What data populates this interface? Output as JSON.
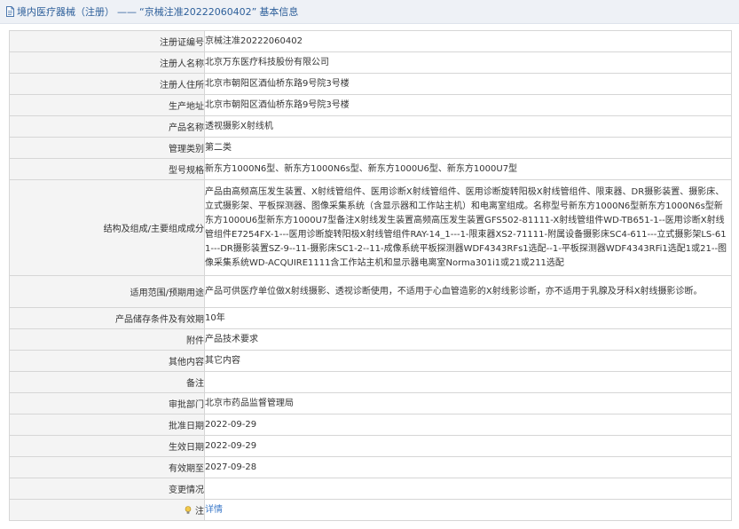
{
  "header": {
    "title": "境内医疗器械（注册）",
    "separator": "——",
    "cert_quote": "“京械注准20222060402”",
    "suffix": "基本信息"
  },
  "rows": [
    {
      "label": "注册证编号",
      "value": "京械注准20222060402"
    },
    {
      "label": "注册人名称",
      "value": "北京万东医疗科技股份有限公司"
    },
    {
      "label": "注册人住所",
      "value": "北京市朝阳区酒仙桥东路9号院3号楼"
    },
    {
      "label": "生产地址",
      "value": "北京市朝阳区酒仙桥东路9号院3号楼"
    },
    {
      "label": "产品名称",
      "value": "透视摄影X射线机"
    },
    {
      "label": "管理类别",
      "value": "第二类"
    },
    {
      "label": "型号规格",
      "value": "新东方1000N6型、新东方1000N6s型、新东方1000U6型、新东方1000U7型"
    },
    {
      "label": "结构及组成/主要组成成分",
      "value": "产品由高频高压发生装置、X射线管组件、医用诊断X射线管组件、医用诊断旋转阳极X射线管组件、限束器、DR摄影装置、摄影床、立式摄影架、平板探测器、图像采集系统（含显示器和工作站主机）和电离室组成。名称型号新东方1000N6型新东方1000N6s型新东方1000U6型新东方1000U7型备注X射线发生装置高频高压发生装置GFS502-81111-X射线管组件WD-TB651-1--医用诊断X射线管组件E7254FX-1---医用诊断旋转阳极X射线管组件RAY-14_1---1-限束器XS2-71111-附属设备摄影床SC4-611---立式摄影架LS-611---DR摄影装置SZ-9--11-摄影床SC1-2--11-成像系统平板探测器WDF4343RFs1选配--1-平板探测器WDF4343RFi1选配1或21--图像采集系统WD-ACQUIRE1111含工作站主机和显示器电离室Norma301i1或21或211选配"
    },
    {
      "label": "适用范围/预期用途",
      "value": "产品可供医疗单位做X射线摄影、透视诊断使用，不适用于心血管造影的X射线影诊断，亦不适用于乳腺及牙科X射线摄影诊断。"
    },
    {
      "label": "产品储存条件及有效期",
      "value": "10年"
    },
    {
      "label": "附件",
      "value": "产品技术要求"
    },
    {
      "label": "其他内容",
      "value": "其它内容"
    },
    {
      "label": "备注",
      "value": ""
    },
    {
      "label": "审批部门",
      "value": "北京市药品监督管理局"
    },
    {
      "label": "批准日期",
      "value": "2022-09-29"
    },
    {
      "label": "生效日期",
      "value": "2022-09-29"
    },
    {
      "label": "有效期至",
      "value": "2027-09-28"
    },
    {
      "label": "变更情况",
      "value": ""
    },
    {
      "label": "注",
      "value": "详情"
    }
  ],
  "icons": {
    "header_icon": "document-icon",
    "note_icon": "lightbulb-icon"
  },
  "colors": {
    "header_text": "#2d5f9a",
    "link": "#3c7ac9",
    "label_bg": "#f4f4f4"
  }
}
